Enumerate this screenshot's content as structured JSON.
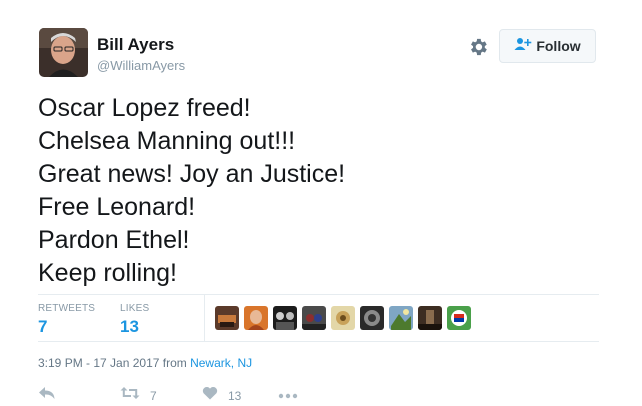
{
  "user": {
    "name": "Bill Ayers",
    "handle": "@WilliamAyers"
  },
  "follow_button": {
    "label": "Follow"
  },
  "tweet": {
    "lines": [
      "Oscar Lopez freed!",
      "Chelsea Manning out!!!",
      "Great news! Joy an Justice!",
      "Free Leonard!",
      "Pardon Ethel!",
      "Keep rolling!"
    ]
  },
  "stats": {
    "retweets_label": "RETWEETS",
    "retweets_count": "7",
    "likes_label": "LIKES",
    "likes_count": "13"
  },
  "timestamp": {
    "text": "3:19 PM - 17 Jan 2017 from ",
    "location": "Newark, NJ"
  },
  "actions": {
    "retweet_count": "7",
    "like_count": "13"
  },
  "colors": {
    "link": "#1b95e0",
    "muted": "#8899a6",
    "border": "#e6ecf0"
  },
  "icons": [
    "gear-icon",
    "follow-person-icon",
    "reply-icon",
    "retweet-icon",
    "heart-icon",
    "more-icon"
  ]
}
